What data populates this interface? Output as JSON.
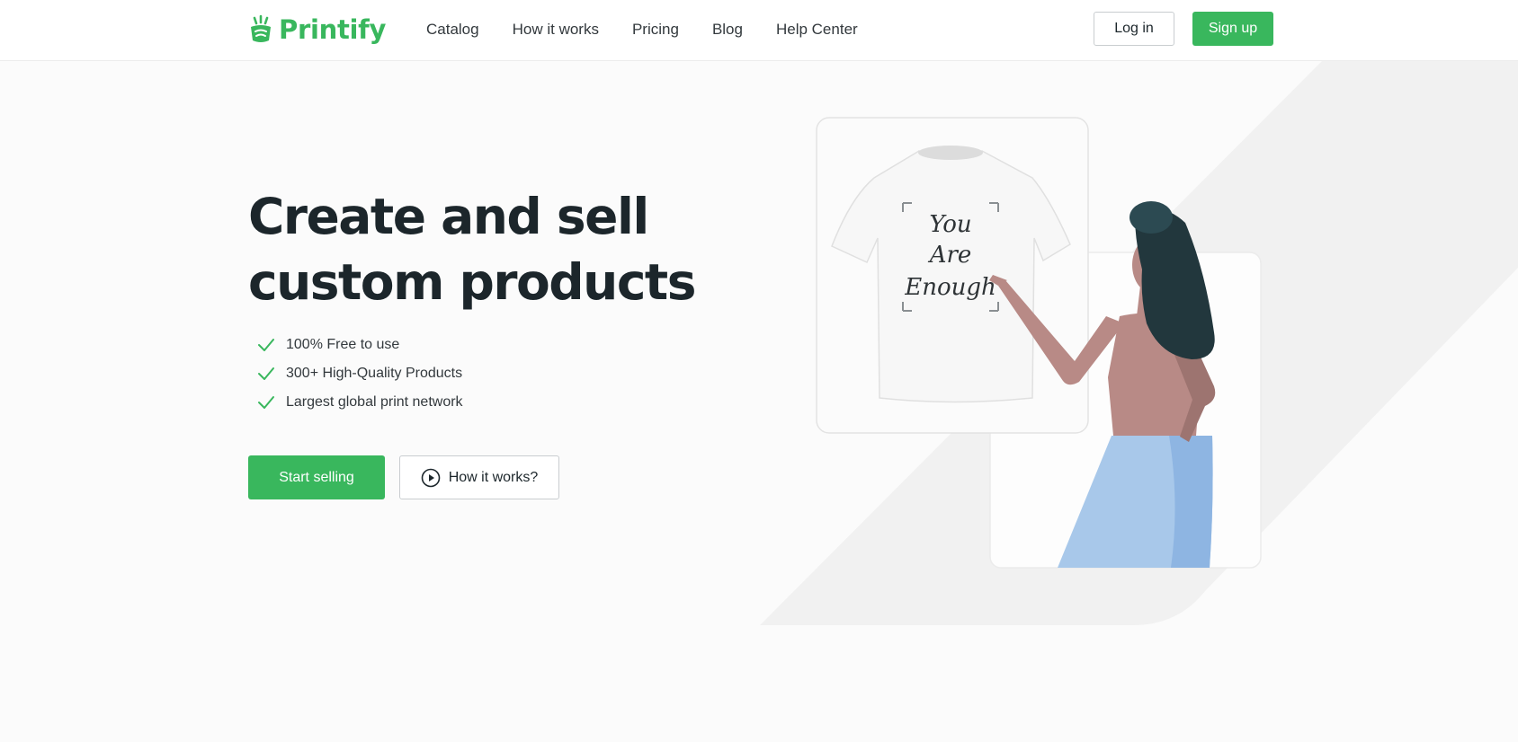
{
  "brand": {
    "name": "Printify",
    "color": "#39b75d"
  },
  "nav": {
    "items": [
      {
        "label": "Catalog"
      },
      {
        "label": "How it works"
      },
      {
        "label": "Pricing"
      },
      {
        "label": "Blog"
      },
      {
        "label": "Help Center"
      }
    ]
  },
  "header": {
    "login_label": "Log in",
    "signup_label": "Sign up"
  },
  "hero": {
    "title_line1": "Create and sell",
    "title_line2": "custom products",
    "features": [
      {
        "text": "100% Free to use",
        "icon": "check-icon"
      },
      {
        "text": "300+ High-Quality Products",
        "icon": "check-icon"
      },
      {
        "text": "Largest global print network",
        "icon": "check-icon"
      }
    ],
    "start_label": "Start selling",
    "how_label": "How it works?",
    "how_icon": "play-circle-icon"
  },
  "illustration": {
    "shirt_text": [
      "You",
      "Are",
      "Enough"
    ]
  },
  "colors": {
    "accent": "#39b75d",
    "text": "#1c262b",
    "skirt": "#a8c8ea",
    "hair": "#22373d",
    "skin": "#b88a86"
  }
}
